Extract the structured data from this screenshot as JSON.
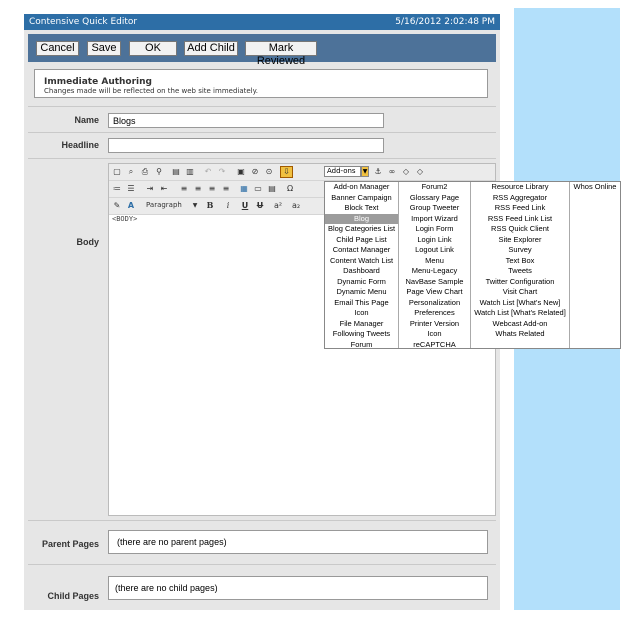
{
  "editor": {
    "title": "Contensive Quick Editor",
    "datetime": "5/16/2012 2:02:48 PM"
  },
  "toolbar": {
    "cancel": "Cancel",
    "save": "Save",
    "ok": "OK",
    "add_child": "Add Child",
    "mark_reviewed": "Mark Reviewed"
  },
  "immediate": {
    "heading": "Immediate Authoring",
    "description": "Changes made will be reflected on the web site immediately."
  },
  "fields": {
    "name_label": "Name",
    "name_value": "Blogs",
    "headline_label": "Headline",
    "headline_value": "",
    "body_label": "Body",
    "parent_label": "Parent Pages",
    "parent_value": "(there are no parent pages)",
    "child_label": "Child Pages",
    "child_value": "(there are no child pages)"
  },
  "rte": {
    "paragraph": "Paragraph",
    "addons_label": "Add-ons",
    "body_tag": "<BODY>",
    "bold": "B",
    "italic": "i",
    "underline": "U",
    "strike": "U",
    "superscript": "a²",
    "subscript": "a₂"
  },
  "addons_menu": {
    "selected": "Blog",
    "col1": [
      "Add-on Manager",
      "Banner Campaign",
      "Block Text",
      "Blog",
      "Blog Categories List",
      "Child Page List",
      "Contact Manager",
      "Content Watch List",
      "Dashboard",
      "Dynamic Form",
      "Dynamic Menu",
      "Email This Page",
      "Icon",
      "File Manager",
      "Following Tweets",
      "Forum"
    ],
    "col2": [
      "Forum2",
      "Glossary Page",
      "Group Tweeter",
      "Import Wizard",
      "Login Form",
      "Login Link",
      "Logout Link",
      "Menu",
      "Menu-Legacy",
      "NavBase Sample",
      "Page View Chart",
      "Personalization",
      "Preferences",
      "Printer Version",
      "Icon",
      "reCAPTCHA"
    ],
    "col3": [
      "Resource Library",
      "RSS Aggregator",
      "RSS Feed Link",
      "RSS Feed Link List",
      "RSS Quick Client",
      "Site Explorer",
      "Survey",
      "Text Box",
      "Tweets",
      "Twitter Configuration",
      "Visit Chart",
      "Watch List [What's New]",
      "Watch List [What's Related]",
      "Webcast Add-on",
      "Whats Related"
    ],
    "col4": [
      "Whos Online"
    ]
  },
  "colors": {
    "title_bar": "#2d6ea6",
    "toolbar": "#4d7299",
    "side_panel": "#b3e0fb",
    "menu_selected": "#9c9c9c"
  },
  "icons": [
    "new-page-icon",
    "preview-icon",
    "print-icon",
    "find-icon",
    "paste-icon",
    "paste-text-icon",
    "undo-icon",
    "redo-icon",
    "image-icon",
    "flash-icon",
    "media-icon",
    "addon-icon",
    "anchor-icon",
    "link-icon",
    "source-icon",
    "ordered-list-icon",
    "unordered-list-icon",
    "indent-icon",
    "outdent-icon",
    "align-left-icon",
    "align-center-icon",
    "align-right-icon",
    "justify-icon",
    "table-icon",
    "hr-icon",
    "special-char-icon",
    "style-icon",
    "font-color-icon"
  ]
}
